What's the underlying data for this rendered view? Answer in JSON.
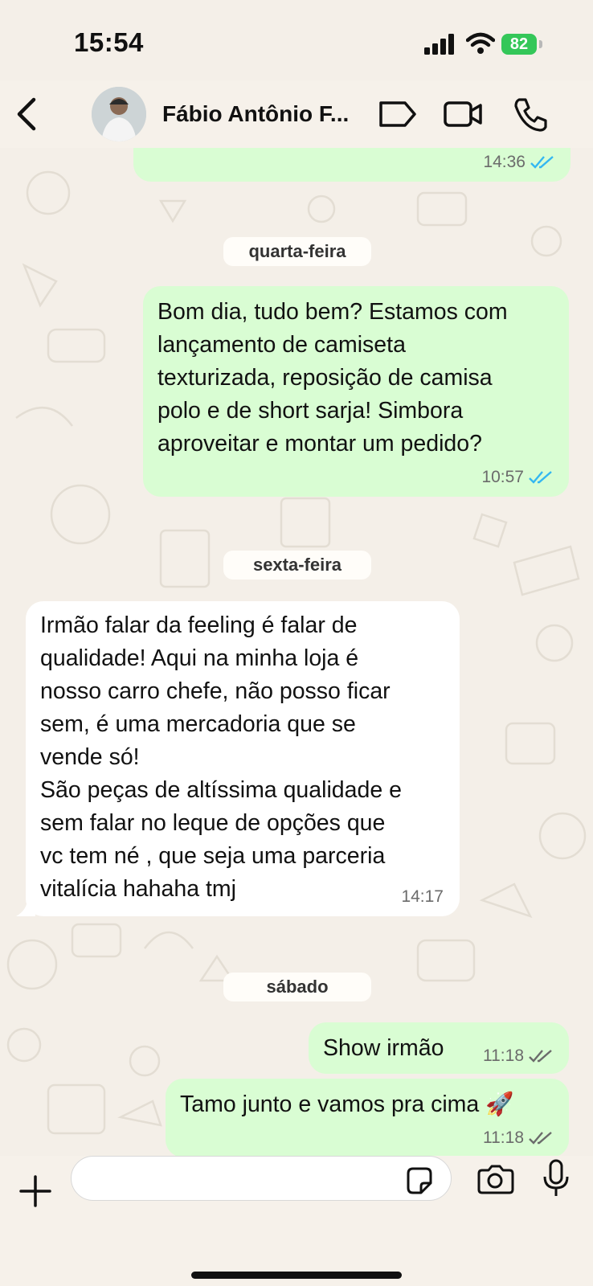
{
  "status_bar": {
    "time": "15:54",
    "battery_level": "82",
    "icons": [
      "cellular-signal-icon",
      "wifi-icon",
      "battery-charging-icon"
    ]
  },
  "header": {
    "contact_name": "Fábio Antônio F...",
    "icons": [
      "chevron-left-icon",
      "label-tag-icon",
      "video-camera-icon",
      "phone-icon"
    ]
  },
  "messages": [
    {
      "direction": "outgoing",
      "text": "",
      "time": "14:36",
      "status": "read"
    },
    {
      "type": "date",
      "label": "quarta-feira"
    },
    {
      "direction": "outgoing",
      "text": "Bom dia, tudo bem? Estamos com\nlançamento de camiseta\ntexturizada, reposição de camisa\npolo e de short sarja! Simbora\naproveitar e montar um pedido?",
      "time": "10:57",
      "status": "read"
    },
    {
      "type": "date",
      "label": "sexta-feira"
    },
    {
      "direction": "incoming",
      "text": "Irmão falar da feeling é falar de\nqualidade! Aqui na minha loja é\nnosso carro chefe, não posso ficar\nsem, é uma mercadoria que se\nvende só!\nSão peças de altíssima qualidade e\nsem falar no leque de opções que\nvc tem né , que seja uma parceria\nvitalícia hahaha tmj",
      "time": "14:17"
    },
    {
      "type": "date",
      "label": "sábado"
    },
    {
      "direction": "outgoing",
      "text": "Show irmão",
      "time": "11:18",
      "status": "delivered"
    },
    {
      "direction": "outgoing",
      "text": "Tamo junto e vamos pra cima 🚀",
      "time": "11:18",
      "status": "delivered"
    }
  ],
  "input_bar": {
    "placeholder": "",
    "icons": [
      "plus-icon",
      "sticker-icon",
      "camera-icon",
      "microphone-icon"
    ]
  },
  "colors": {
    "outgoing_bubble": "#d9fdd3",
    "incoming_bubble": "#ffffff",
    "read_ticks": "#34b7f1",
    "delivered_ticks": "#6b6b6b",
    "battery": "#34c759",
    "wallpaper": "#f4efe8"
  }
}
